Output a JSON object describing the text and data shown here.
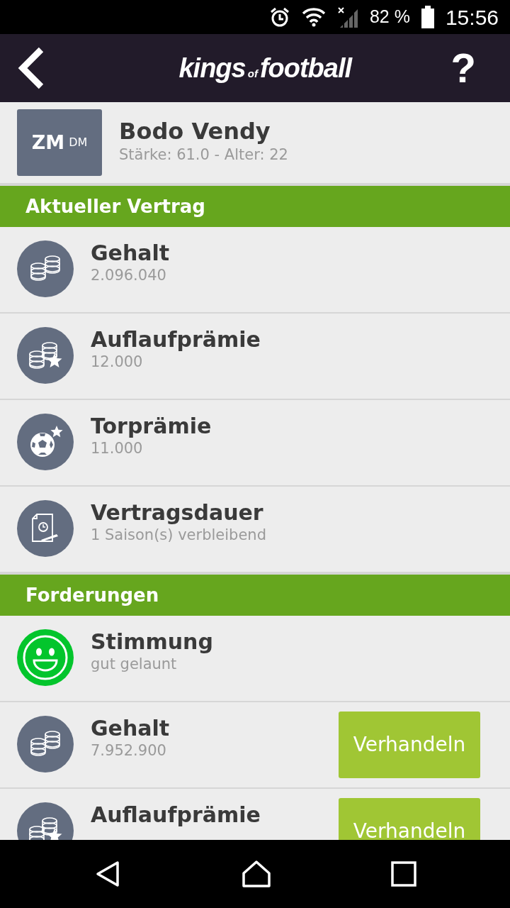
{
  "status_bar": {
    "battery": "82 %",
    "time": "15:56"
  },
  "header": {
    "logo": [
      {
        "kind": "big",
        "text": "kings"
      },
      {
        "kind": "small",
        "text": "of"
      },
      {
        "kind": "big",
        "text": "football"
      }
    ],
    "help": "?"
  },
  "player": {
    "position": "ZM",
    "secondary_position": "DM",
    "name": "Bodo Vendy",
    "details": "Stärke: 61.0 - Alter: 22"
  },
  "sections": [
    {
      "title": "Aktueller Vertrag",
      "rows": [
        {
          "kind": "coins",
          "title": "Gehalt",
          "value": "2.096.040"
        },
        {
          "kind": "coins-star",
          "title": "Auflaufprämie",
          "value": "12.000"
        },
        {
          "kind": "ball-star",
          "title": "Torprämie",
          "value": "11.000"
        },
        {
          "kind": "contract",
          "title": "Vertragsdauer",
          "value": "1 Saison(s) verbleibend"
        }
      ]
    },
    {
      "title": "Forderungen",
      "rows": [
        {
          "kind": "smiley",
          "title": "Stimmung",
          "value": "gut gelaunt"
        },
        {
          "kind": "coins",
          "title": "Gehalt",
          "value": "7.952.900",
          "button": "Verhandeln"
        },
        {
          "kind": "coins-star",
          "title": "Auflaufprämie",
          "button": "Verhandeln"
        }
      ]
    }
  ]
}
